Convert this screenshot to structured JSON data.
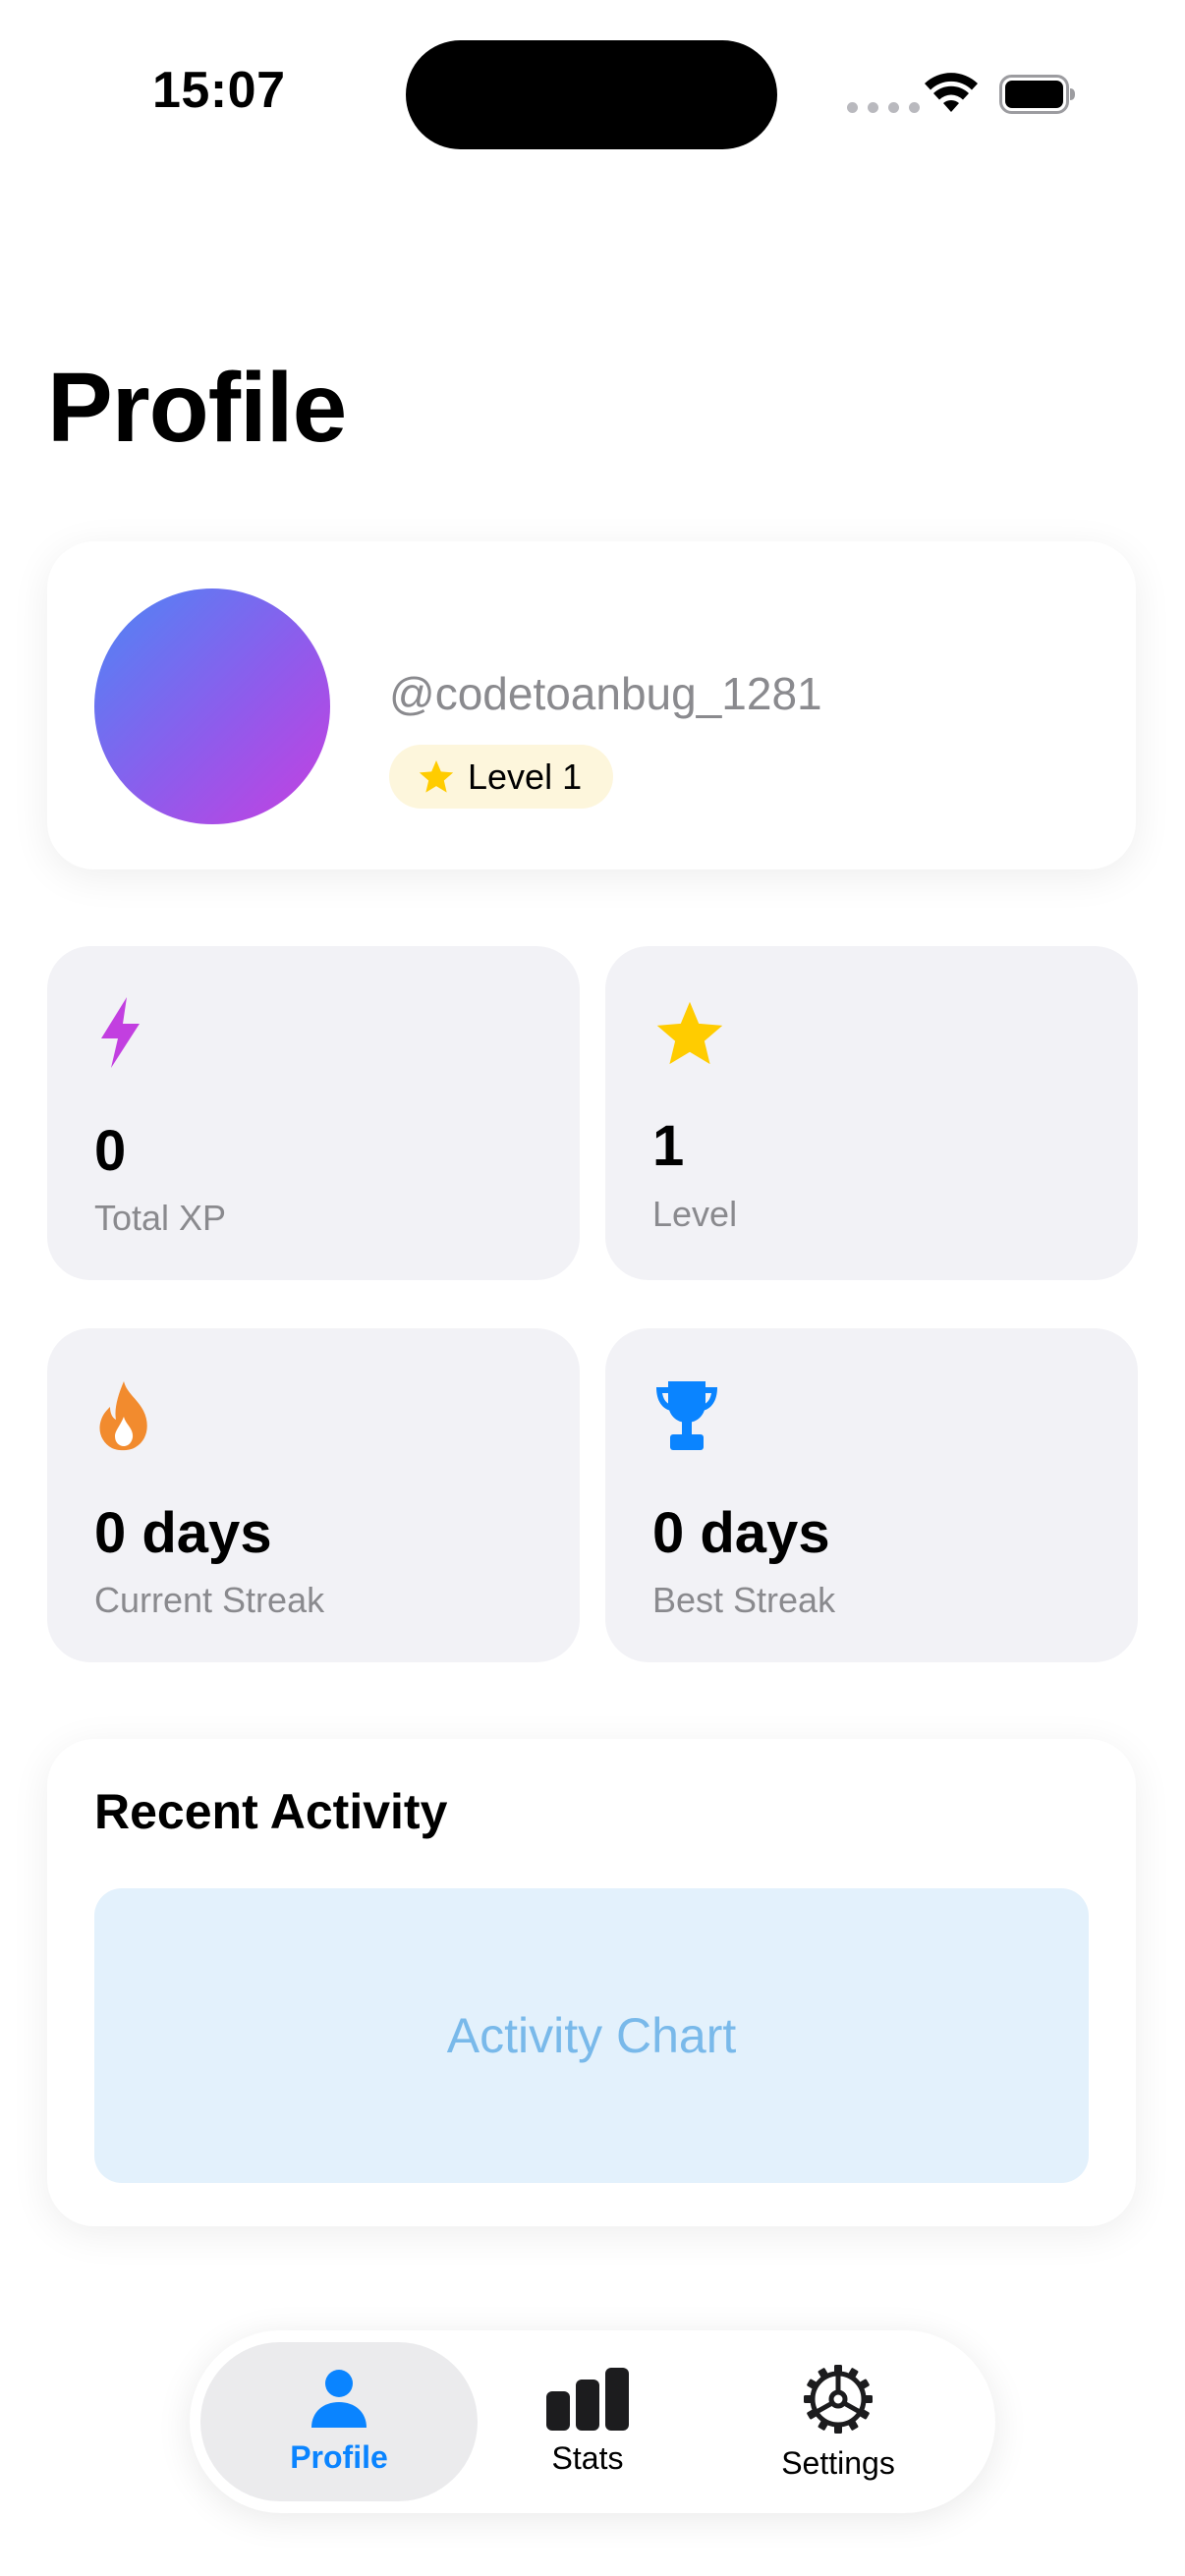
{
  "status_bar": {
    "time": "15:07"
  },
  "page": {
    "title": "Profile"
  },
  "profile": {
    "username": "@codetoanbug_1281",
    "level_badge": "Level 1"
  },
  "stats": [
    {
      "icon": "lightning-icon",
      "value": "0",
      "label": "Total XP",
      "icon_color": "#c23fe0"
    },
    {
      "icon": "star-icon",
      "value": "1",
      "label": "Level",
      "icon_color": "#ffcc00"
    },
    {
      "icon": "flame-icon",
      "value": "0 days",
      "label": "Current Streak",
      "icon_color": "#f28b2e"
    },
    {
      "icon": "trophy-icon",
      "value": "0 days",
      "label": "Best Streak",
      "icon_color": "#0a84ff"
    }
  ],
  "activity": {
    "title": "Recent Activity",
    "chart_placeholder": "Activity Chart"
  },
  "tab_bar": {
    "active": "Profile",
    "tabs": [
      {
        "label": "Profile",
        "icon": "person-icon"
      },
      {
        "label": "Stats",
        "icon": "bar-chart-icon"
      },
      {
        "label": "Settings",
        "icon": "gear-icon"
      }
    ]
  },
  "colors": {
    "accent": "#0a84ff",
    "card_background": "#f2f2f6",
    "badge_background": "#fdf6dc",
    "chart_background": "#e3f1fc"
  }
}
